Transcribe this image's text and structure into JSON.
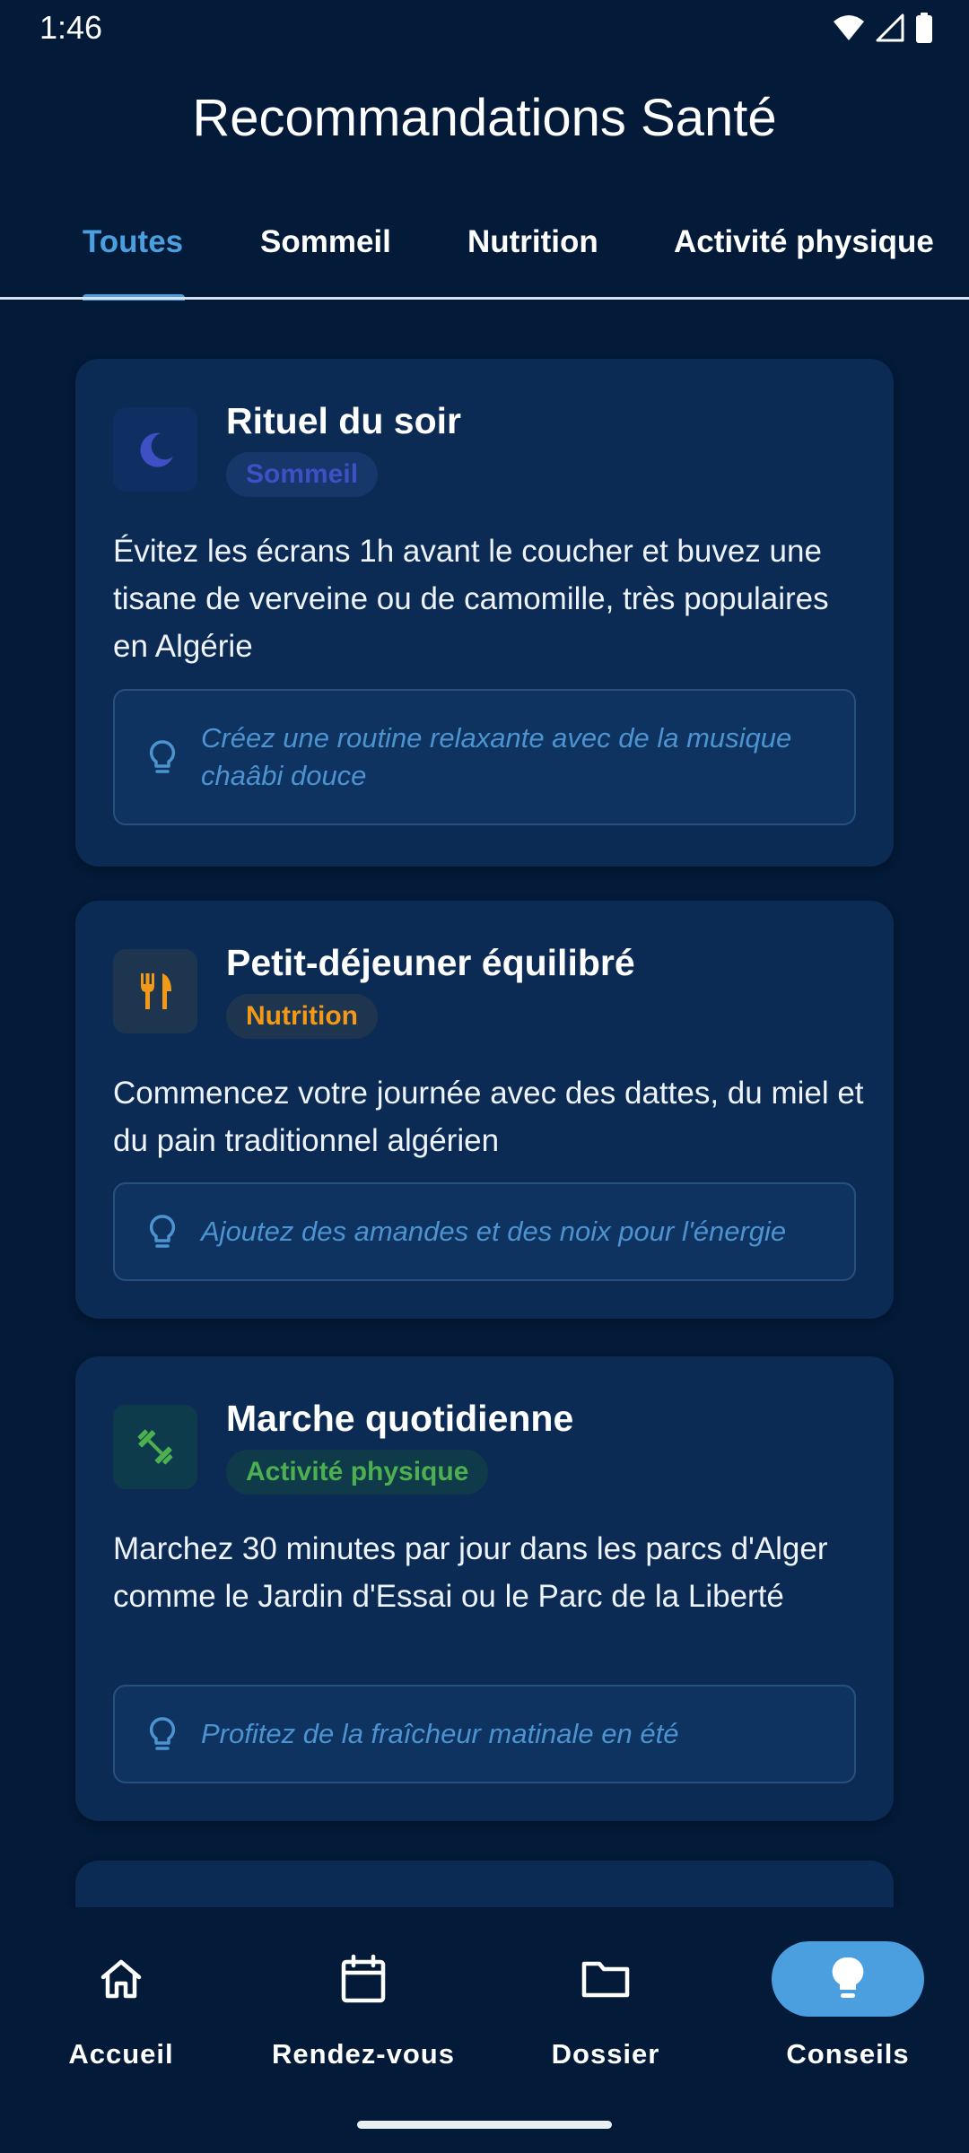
{
  "status_bar": {
    "time": "1:46"
  },
  "header": {
    "title": "Recommandations Santé"
  },
  "tabs": [
    {
      "label": "Toutes",
      "active": true
    },
    {
      "label": "Sommeil",
      "active": false
    },
    {
      "label": "Nutrition",
      "active": false
    },
    {
      "label": "Activité physique",
      "active": false
    }
  ],
  "cards": [
    {
      "title": "Rituel du soir",
      "category": "Sommeil",
      "icon": "moon-icon",
      "accent_color": "#3f4fc4",
      "description": "Évitez les écrans 1h avant le coucher et buvez une tisane de verveine ou de camomille, très populaires en Algérie",
      "tip": "Créez une routine relaxante avec de la musique chaâbi douce"
    },
    {
      "title": "Petit-déjeuner équilibré",
      "category": "Nutrition",
      "icon": "fork-knife-icon",
      "accent_color": "#f29a17",
      "description": "Commencez votre journée avec des dattes, du miel et du pain traditionnel algérien",
      "tip": "Ajoutez des amandes et des noix pour l'énergie"
    },
    {
      "title": "Marche quotidienne",
      "category": "Activité physique",
      "icon": "dumbbell-icon",
      "accent_color": "#4caf50",
      "description": "Marchez 30 minutes par jour dans les parcs d'Alger comme le Jardin d'Essai ou le Parc de la Liberté",
      "tip": "Profitez de la fraîcheur matinale en été"
    }
  ],
  "bottom_nav": [
    {
      "label": "Accueil",
      "icon": "home-icon",
      "active": false
    },
    {
      "label": "Rendez-vous",
      "icon": "calendar-icon",
      "active": false
    },
    {
      "label": "Dossier",
      "icon": "folder-icon",
      "active": false
    },
    {
      "label": "Conseils",
      "icon": "lightbulb-icon",
      "active": true
    }
  ],
  "colors": {
    "background": "#031a38",
    "card": "#0b2b55",
    "accent": "#4c9fde"
  }
}
